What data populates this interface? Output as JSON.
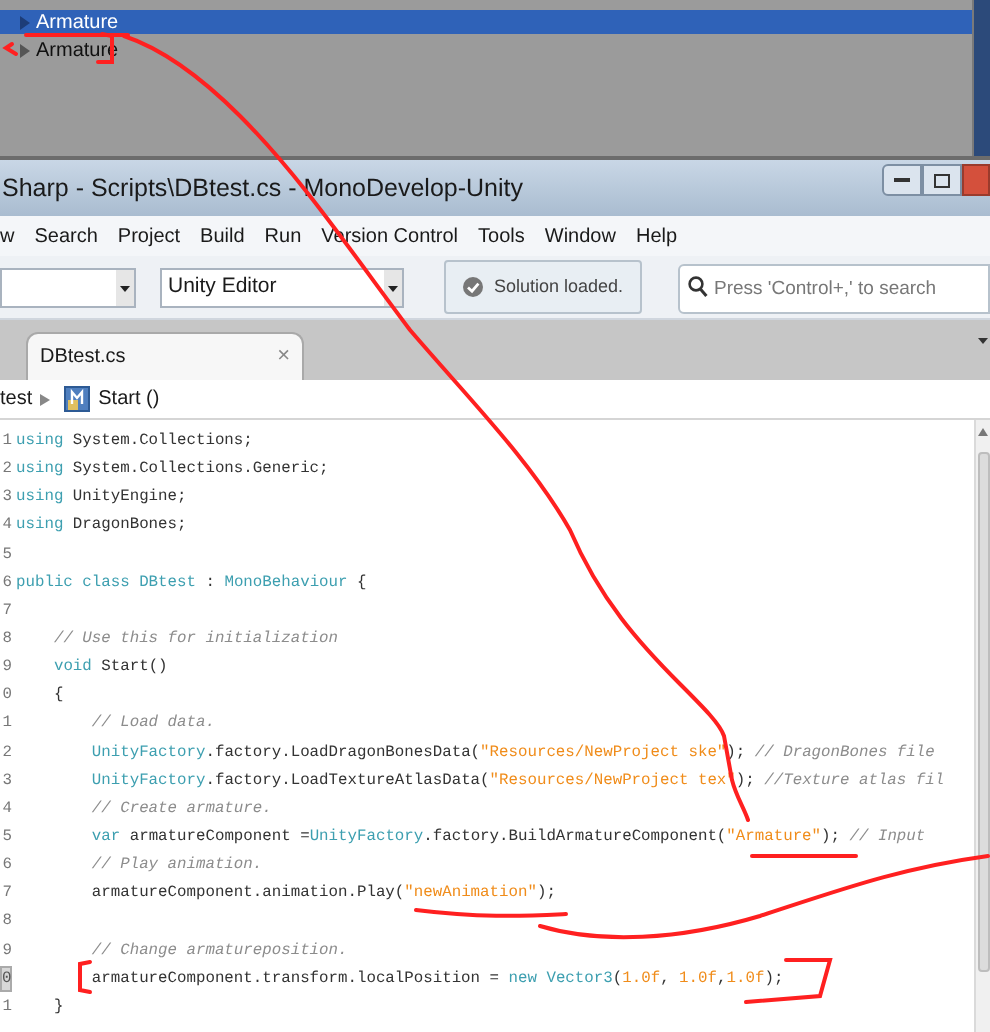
{
  "hierarchy": {
    "items": [
      {
        "label": "Armature",
        "selected": true
      },
      {
        "label": "Armature",
        "selected": false
      }
    ]
  },
  "window": {
    "title": "Sharp - Scripts\\DBtest.cs - MonoDevelop-Unity"
  },
  "menu": [
    "w",
    "Search",
    "Project",
    "Build",
    "Run",
    "Version Control",
    "Tools",
    "Window",
    "Help"
  ],
  "toolbar": {
    "target": "Unity Editor",
    "status": "Solution loaded.",
    "search": {
      "placeholder": "Press 'Control+,' to search"
    }
  },
  "tabs": [
    {
      "label": "DBtest.cs",
      "close": "×",
      "selected": true
    }
  ],
  "breadcrumb": {
    "class_name": "test",
    "method": "Start ()"
  },
  "editor": {
    "lines": [
      {
        "no": "1",
        "current": false,
        "tokens": [
          {
            "kind": "keyword",
            "text": "using"
          },
          {
            "kind": "plain",
            "text": " System.Collections;"
          }
        ]
      },
      {
        "no": "2",
        "current": false,
        "tokens": [
          {
            "kind": "keyword",
            "text": "using"
          },
          {
            "kind": "plain",
            "text": " System.Collections.Generic;"
          }
        ]
      },
      {
        "no": "3",
        "current": false,
        "tokens": [
          {
            "kind": "keyword",
            "text": "using"
          },
          {
            "kind": "plain",
            "text": " UnityEngine;"
          }
        ]
      },
      {
        "no": "4",
        "current": false,
        "tokens": [
          {
            "kind": "keyword",
            "text": "using"
          },
          {
            "kind": "plain",
            "text": " DragonBones;"
          }
        ]
      },
      {
        "no": "5",
        "current": false
      },
      {
        "no": "6",
        "current": false,
        "tokens": [
          {
            "kind": "keyword",
            "text": "public class "
          },
          {
            "kind": "type",
            "text": "DBtest"
          },
          {
            "kind": "plain",
            "text": " : "
          },
          {
            "kind": "type",
            "text": "MonoBehaviour"
          },
          {
            "kind": "plain",
            "text": " {"
          }
        ]
      },
      {
        "no": "7",
        "current": false
      },
      {
        "no": "8",
        "current": false,
        "tokens": [
          {
            "kind": "comment",
            "text": "    // Use this for initialization"
          }
        ]
      },
      {
        "no": "9",
        "current": false,
        "tokens": [
          {
            "kind": "keyword",
            "text": "    void"
          },
          {
            "kind": "plain",
            "text": " Start()"
          }
        ]
      },
      {
        "no": "0",
        "current": false,
        "tokens": [
          {
            "kind": "plain",
            "text": "    {"
          }
        ]
      },
      {
        "no": "1",
        "current": false,
        "tokens": [
          {
            "kind": "comment",
            "text": "        // Load data."
          }
        ]
      },
      {
        "no": "2",
        "current": false,
        "tokens": [
          {
            "kind": "type",
            "text": "        UnityFactory"
          },
          {
            "kind": "plain",
            "text": ".factory.LoadDragonBonesData("
          },
          {
            "kind": "string",
            "text": "\"Resources/NewProject ske\""
          },
          {
            "kind": "plain",
            "text": "); "
          },
          {
            "kind": "comment",
            "text": "// DragonBones file"
          }
        ]
      },
      {
        "no": "3",
        "current": false,
        "tokens": [
          {
            "kind": "type",
            "text": "        UnityFactory"
          },
          {
            "kind": "plain",
            "text": ".factory.LoadTextureAtlasData("
          },
          {
            "kind": "string",
            "text": "\"Resources/NewProject tex\""
          },
          {
            "kind": "plain",
            "text": "); "
          },
          {
            "kind": "comment",
            "text": "//Texture atlas fil"
          }
        ]
      },
      {
        "no": "4",
        "current": false,
        "tokens": [
          {
            "kind": "comment",
            "text": "        // Create armature."
          }
        ]
      },
      {
        "no": "5",
        "current": false,
        "tokens": [
          {
            "kind": "keyword",
            "text": "        var"
          },
          {
            "kind": "plain",
            "text": " armatureComponent ="
          },
          {
            "kind": "type",
            "text": "UnityFactory"
          },
          {
            "kind": "plain",
            "text": ".factory.BuildArmatureComponent("
          },
          {
            "kind": "string",
            "text": "\"Armature\""
          },
          {
            "kind": "plain",
            "text": "); "
          },
          {
            "kind": "comment",
            "text": "// Input"
          }
        ]
      },
      {
        "no": "6",
        "current": false,
        "tokens": [
          {
            "kind": "comment",
            "text": "        // Play animation."
          }
        ]
      },
      {
        "no": "7",
        "current": false,
        "tokens": [
          {
            "kind": "plain",
            "text": "        armatureComponent.animation.Play("
          },
          {
            "kind": "string",
            "text": "\"newAnimation\""
          },
          {
            "kind": "plain",
            "text": ");"
          }
        ]
      },
      {
        "no": "8",
        "current": false
      },
      {
        "no": "9",
        "current": false,
        "tokens": [
          {
            "kind": "comment",
            "text": "        // Change armatureposition."
          }
        ]
      },
      {
        "no": "0",
        "current": true,
        "tokens": [
          {
            "kind": "plain",
            "text": "        armatureComponent.transform.localPosition = "
          },
          {
            "kind": "keyword",
            "text": "new "
          },
          {
            "kind": "type",
            "text": "Vector3"
          },
          {
            "kind": "plain",
            "text": "("
          },
          {
            "kind": "string",
            "text": "1.0f"
          },
          {
            "kind": "plain",
            "text": ", "
          },
          {
            "kind": "string",
            "text": "1.0f"
          },
          {
            "kind": "plain",
            "text": ","
          },
          {
            "kind": "string",
            "text": "1.0f"
          },
          {
            "kind": "plain",
            "text": ");"
          }
        ]
      },
      {
        "no": "1",
        "current": false,
        "tokens": [
          {
            "kind": "plain",
            "text": "    }"
          }
        ]
      }
    ]
  }
}
